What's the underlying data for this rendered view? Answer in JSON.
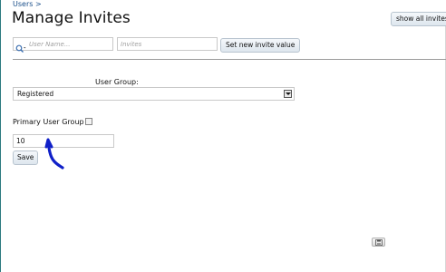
{
  "breadcrumb": "Users >",
  "page_title": "Manage Invites",
  "header": {
    "show_all_label": "show all invites"
  },
  "search": {
    "username_placeholder": "User Name...",
    "invites_placeholder": "Invites",
    "set_button_label": "Set new invite value"
  },
  "form": {
    "user_group_label": "User Group:",
    "user_group_selected": "Registered",
    "primary_group_label": "Primary User Group",
    "primary_group_value": "10",
    "save_label": "Save"
  },
  "icons": {
    "search": "search-icon",
    "dropdown": "chevron-down-icon",
    "footer_button": "save-icon"
  },
  "colors": {
    "link": "#1a4f8a",
    "annotation": "#1020c8",
    "left_rule": "#2c7a7f"
  }
}
